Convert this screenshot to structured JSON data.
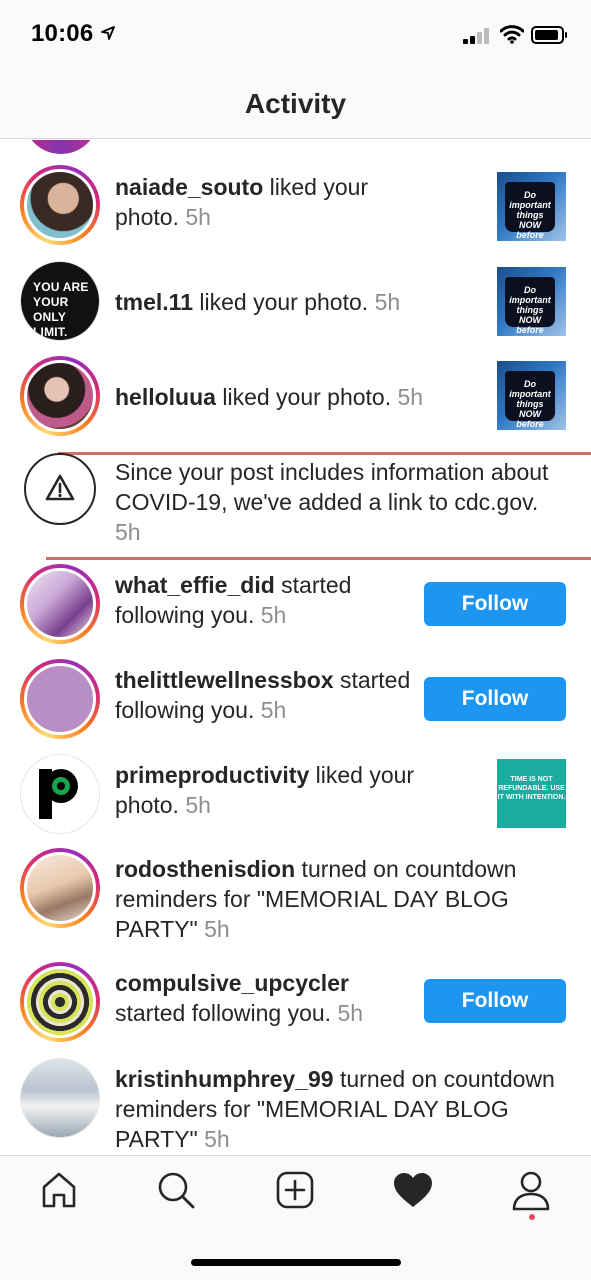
{
  "status_bar": {
    "time": "10:06",
    "location_icon": "location-arrow-icon",
    "signal_icon": "cellular-signal-icon",
    "wifi_icon": "wifi-icon",
    "battery_icon": "battery-icon"
  },
  "header": {
    "title": "Activity"
  },
  "notifications": [
    {
      "username": "naiade_souto",
      "action": " liked your photo.",
      "time": "5h",
      "thumb_text": "Do important things NOW before they become URGENT"
    },
    {
      "username": "tmel.11",
      "action": " liked your photo.",
      "time": "5h",
      "avatar_text": "YOU ARE YOUR ONLY LIMIT.",
      "thumb_text": "Do important things NOW before they become URGENT"
    },
    {
      "username": "helloluua",
      "action": " liked your photo.",
      "time": "5h",
      "thumb_text": "Do important things NOW before they become URGENT"
    },
    {
      "message": "Since your post includes information about COVID-19, we've added a link to cdc.gov.",
      "time": "5h",
      "icon": "warning-icon"
    },
    {
      "username": "what_effie_did",
      "action": " started following you.",
      "time": "5h",
      "button": "Follow"
    },
    {
      "username": "thelittlewellnessbox",
      "action": " started following you.",
      "time": "5h",
      "button": "Follow"
    },
    {
      "username": "primeproductivity",
      "action": " liked your photo.",
      "time": "5h",
      "thumb_text": "TIME IS NOT REFUNDABLE. USE IT WITH INTENTION."
    },
    {
      "username": "rodosthenisdion",
      "action": " turned on countdown reminders for \"MEMORIAL DAY BLOG PARTY\"",
      "time": "5h"
    },
    {
      "username": "compulsive_upcycler",
      "action": " started following you.",
      "time": "5h",
      "button": "Follow"
    },
    {
      "username": "kristinhumphrey_99",
      "action": " turned on countdown reminders for \"MEMORIAL DAY BLOG PARTY\"",
      "time": "5h"
    }
  ],
  "tab_bar": {
    "items": [
      "home-icon",
      "search-icon",
      "new-post-icon",
      "activity-heart-icon",
      "profile-icon"
    ],
    "active": "activity-heart-icon"
  },
  "colors": {
    "follow_button": "#1c96f0",
    "timestamp": "#8e8e8e",
    "notification_dot": "#ed4956",
    "annotation_line": "#c95552"
  }
}
